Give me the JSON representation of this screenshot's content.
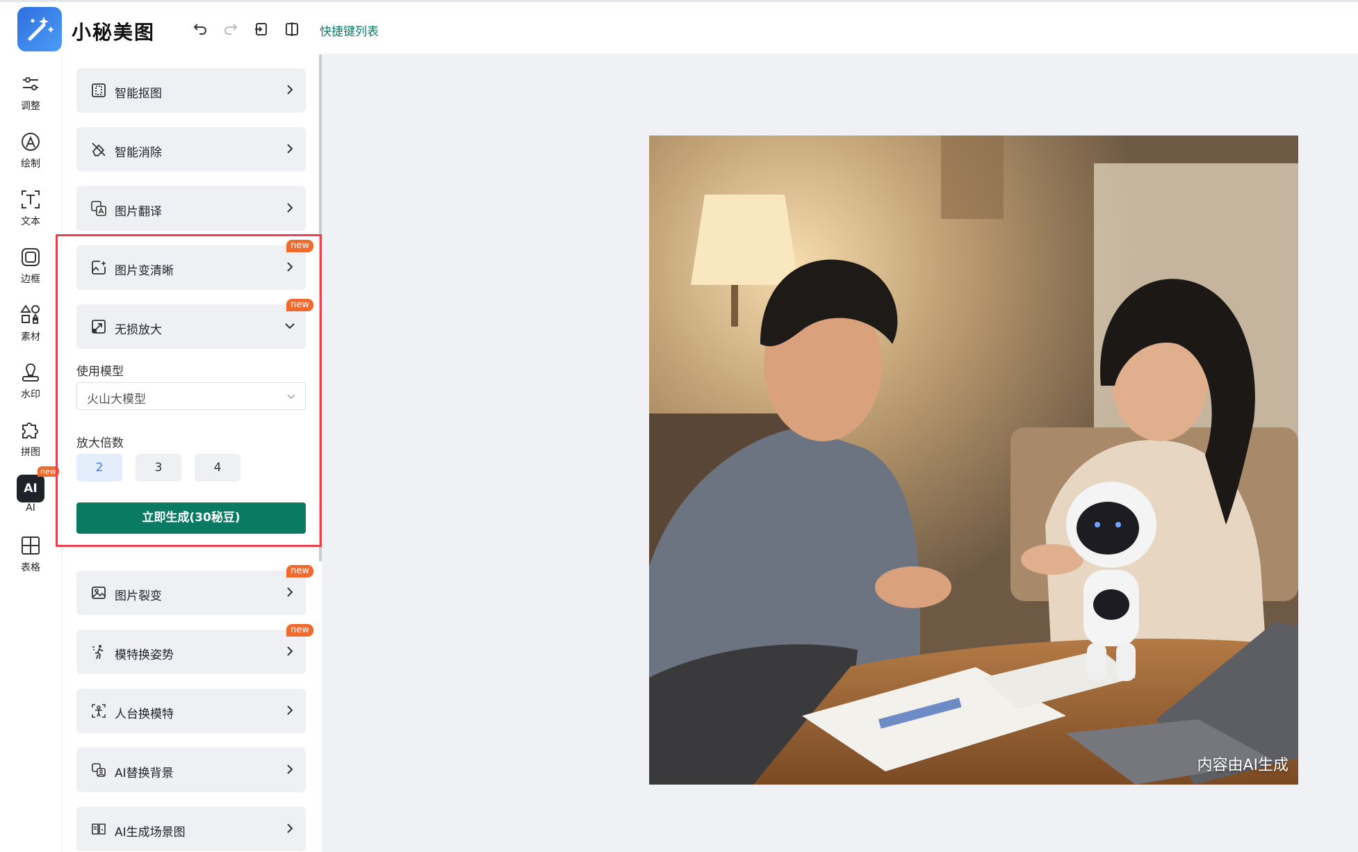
{
  "app": {
    "title": "小秘美图"
  },
  "toolbar": {
    "shortcut_label": "快捷键列表"
  },
  "rail": [
    {
      "label": "调整",
      "icon": "sliders-icon"
    },
    {
      "label": "绘制",
      "icon": "draw-icon"
    },
    {
      "label": "文本",
      "icon": "text-icon"
    },
    {
      "label": "边框",
      "icon": "frame-icon"
    },
    {
      "label": "素材",
      "icon": "shapes-icon"
    },
    {
      "label": "水印",
      "icon": "stamp-icon"
    },
    {
      "label": "拼图",
      "icon": "puzzle-icon"
    },
    {
      "label": "AI",
      "icon": "ai-icon",
      "badge": "new",
      "active": true
    },
    {
      "label": "表格",
      "icon": "table-icon"
    }
  ],
  "tools": {
    "cutout": {
      "label": "智能抠图"
    },
    "erase": {
      "label": "智能消除"
    },
    "translate": {
      "label": "图片翻译"
    },
    "sharpen": {
      "label": "图片变清晰",
      "badge": "new"
    },
    "upscale": {
      "label": "无损放大",
      "badge": "new"
    },
    "fission": {
      "label": "图片裂变",
      "badge": "new"
    },
    "pose": {
      "label": "模特换姿势",
      "badge": "new"
    },
    "mannequin": {
      "label": "人台换模特"
    },
    "bg": {
      "label": "AI替换背景"
    },
    "scene": {
      "label": "AI生成场景图"
    }
  },
  "upscale_panel": {
    "model_label": "使用模型",
    "model_value": "火山大模型",
    "scale_label": "放大倍数",
    "scales": [
      "2",
      "3",
      "4"
    ],
    "selected_scale": "2",
    "generate_label": "立即生成(30秘豆)"
  },
  "canvas": {
    "watermark": "内容由AI生成"
  },
  "colors": {
    "accent": "#0a7a63",
    "badge": "#f06a2d",
    "highlight": "#e6434e"
  }
}
